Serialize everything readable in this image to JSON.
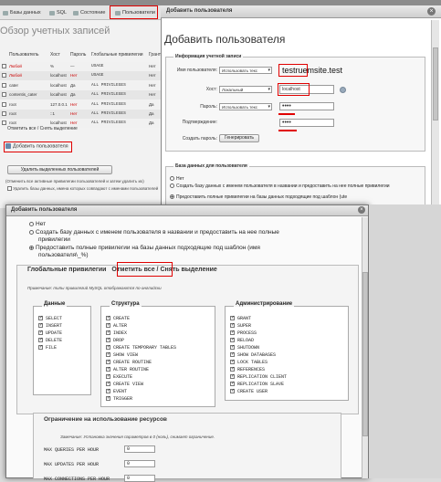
{
  "window": {
    "title": ""
  },
  "tabs": [
    {
      "label": "Базы данных"
    },
    {
      "label": "SQL"
    },
    {
      "label": "Состояние"
    },
    {
      "label": "Пользователи"
    }
  ],
  "overview": {
    "title": "Обзор учетных записей",
    "columns": [
      "Пользователь",
      "Хост",
      "Пароль",
      "Глобальные привилегии",
      "Грант"
    ],
    "rows": [
      {
        "user": "Любой",
        "host": "%",
        "password": "—",
        "privileges": "USAGE",
        "grant": "Нет",
        "red": true
      },
      {
        "user": "Любой",
        "host": "localhost",
        "password": "Нет",
        "privileges": "USAGE",
        "grant": "Нет",
        "red": true
      },
      {
        "user": "cater",
        "host": "localhost",
        "password": "Да",
        "privileges": "ALL PRIVILEGES",
        "grant": "Нет",
        "red": false
      },
      {
        "user": "contentis_cater",
        "host": "localhost",
        "password": "Да",
        "privileges": "ALL PRIVILEGES",
        "grant": "Нет",
        "red": false
      },
      {
        "user": "root",
        "host": "127.0.0.1",
        "password": "Нет",
        "privileges": "ALL PRIVILEGES",
        "grant": "Да",
        "red": false
      },
      {
        "user": "root",
        "host": "::1",
        "password": "Нет",
        "privileges": "ALL PRIVILEGES",
        "grant": "Да",
        "red": false
      },
      {
        "user": "root",
        "host": "localhost",
        "password": "Нет",
        "privileges": "ALL PRIVILEGES",
        "grant": "Да",
        "red": false
      }
    ],
    "select_links": "Отметить все / Снять выделение",
    "add_user": "Добавить пользователя",
    "delete_selected": "Удалить выделенных пользователей",
    "revoke_note": "(Отменить все активные привилегии пользователей и затем удалить их)",
    "drop_db_note": "Удалить базы данных, имена которых совпадают с именами пользователей"
  },
  "dialog1": {
    "header": "Добавить пользователя",
    "title": "Добавить пользователя",
    "login_legend": "Информация учетной записи",
    "username_label": "Имя пользователя:",
    "username_mode": "Использовать текс",
    "username_value": "testruemsite.test",
    "host_label": "Хост:",
    "host_mode": "Локальный",
    "host_value": "localhost",
    "password_label": "Пароль:",
    "password_mode": "Использовать текс",
    "password_value": "••••",
    "confirm_label": "Подтверждение:",
    "confirm_value": "••••",
    "generate_label": "Создать пароль:",
    "generate_button": "Генерировать",
    "db_legend": "База данных для пользователя",
    "db_none": "Нет",
    "db_create": "Создать базу данных с именем пользователя в названии и предоставить на нее полные привилегии",
    "db_wildcard": "Предоставить полные привилегии на базы данных подходящие под шаблон (ute"
  },
  "dialog2": {
    "header": "Добавить пользователя",
    "db_none": "Нет",
    "db_create_1": "Создать базу данных с именем пользователя в названии и предоставить на нее полные",
    "db_create_2": "привилегии",
    "db_wildcard_1": "Предоставить полные привилегии на базы данных подходящие под шаблон (имя",
    "db_wildcard_2": "пользователя\\_%)",
    "global_legend": "Глобальные привилегии",
    "check_all": "Отметить все",
    "separator": "/",
    "uncheck_all": "Снять выделение",
    "note": "Примечание: типы привилегий MySQL отображаются по-английски",
    "groups": [
      {
        "title": "Данные",
        "items": [
          "SELECT",
          "INSERT",
          "UPDATE",
          "DELETE",
          "FILE"
        ]
      },
      {
        "title": "Структура",
        "items": [
          "CREATE",
          "ALTER",
          "INDEX",
          "DROP",
          "CREATE TEMPORARY TABLES",
          "SHOW VIEW",
          "CREATE ROUTINE",
          "ALTER ROUTINE",
          "EXECUTE",
          "CREATE VIEW",
          "EVENT",
          "TRIGGER"
        ]
      },
      {
        "title": "Администрирование",
        "items": [
          "GRANT",
          "SUPER",
          "PROCESS",
          "RELOAD",
          "SHUTDOWN",
          "SHOW DATABASES",
          "LOCK TABLES",
          "REFERENCES",
          "REPLICATION CLIENT",
          "REPLICATION SLAVE",
          "CREATE USER"
        ]
      }
    ],
    "limits_legend": "Ограничение на использование ресурсов",
    "limits_note": "Замечание: Установка значения параметров в 0 (ноль), снимает ограничение.",
    "limits": [
      {
        "label": "MAX QUERIES PER HOUR",
        "value": "0"
      },
      {
        "label": "MAX UPDATES PER HOUR",
        "value": "0"
      },
      {
        "label": "MAX CONNECTIONS PER HOUR",
        "value": "0"
      }
    ]
  },
  "colors": {
    "highlight": "#e00000",
    "error_text": "#cc0000"
  }
}
